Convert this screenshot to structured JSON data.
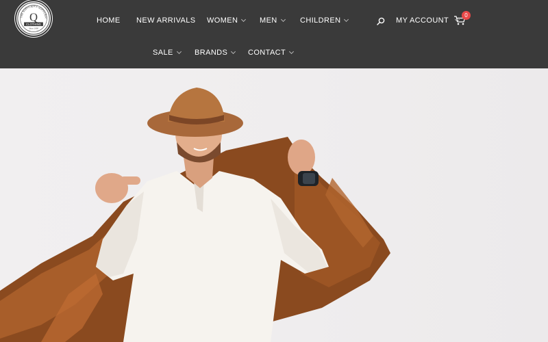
{
  "logo": {
    "top_text": "THE SUPPLIER'S SUPPLIER",
    "letter": "Q",
    "word": "CLOTHING",
    "tagline": "Since 1990"
  },
  "nav": {
    "row1": [
      {
        "label": "HOME",
        "dropdown": false
      },
      {
        "label": "NEW ARRIVALS",
        "dropdown": false
      },
      {
        "label": "WOMEN",
        "dropdown": true
      },
      {
        "label": "MEN",
        "dropdown": true
      },
      {
        "label": "CHILDREN",
        "dropdown": true
      }
    ],
    "row2": [
      {
        "label": "SALE",
        "dropdown": true
      },
      {
        "label": "BRANDS",
        "dropdown": true
      },
      {
        "label": "CONTACT",
        "dropdown": true
      }
    ]
  },
  "account": {
    "label": "MY ACCOUNT"
  },
  "cart": {
    "count": "0"
  },
  "icons": {
    "search": "search-icon",
    "cart": "cart-icon"
  },
  "colors": {
    "header_bg": "#3a3a3a",
    "badge": "#e84848",
    "hero_bg": "#efedee"
  },
  "hero": {
    "image": "man-in-hat-with-brown-jacket"
  }
}
